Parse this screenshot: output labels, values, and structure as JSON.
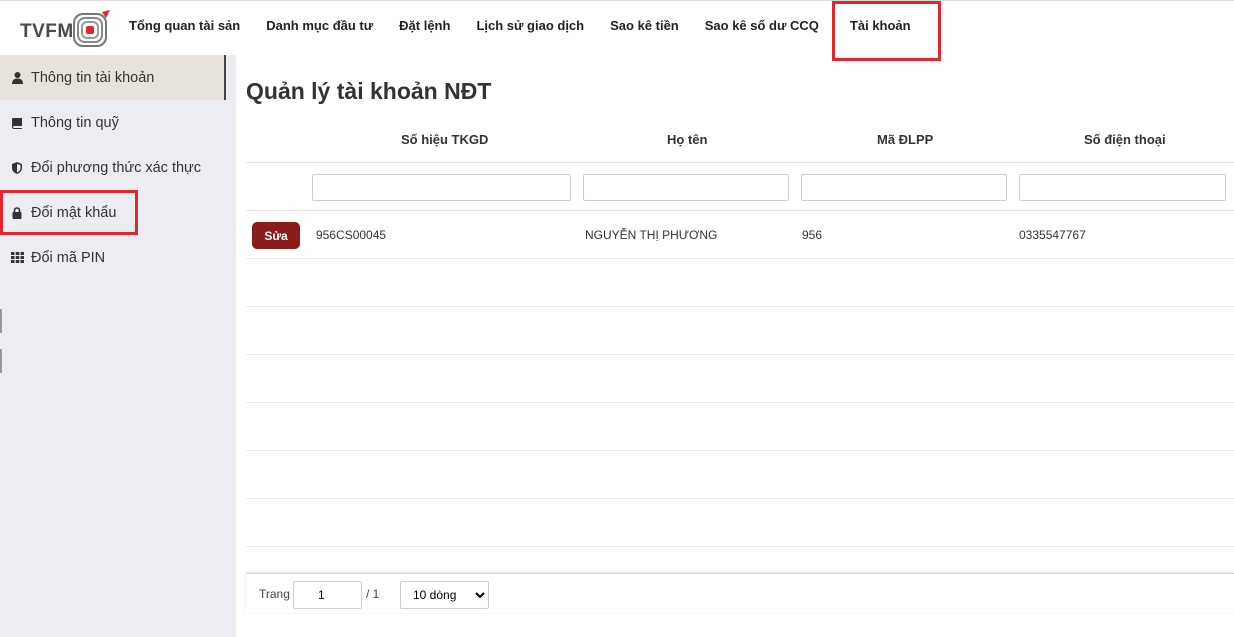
{
  "brand": {
    "logo_text": "TVFM"
  },
  "nav": {
    "items": [
      {
        "label": "Tổng quan tài sản"
      },
      {
        "label": "Danh mục đầu tư"
      },
      {
        "label": "Đặt lệnh"
      },
      {
        "label": "Lịch sử giao dịch"
      },
      {
        "label": "Sao kê tiền"
      },
      {
        "label": "Sao kê số dư CCQ"
      },
      {
        "label": "Tài khoản"
      }
    ],
    "active_index": 6
  },
  "sidebar": {
    "items": [
      {
        "label": "Thông tin tài khoản",
        "icon": "user-icon"
      },
      {
        "label": "Thông tin quỹ",
        "icon": "book-icon"
      },
      {
        "label": "Đổi phương thức xác thực",
        "icon": "shield-icon"
      },
      {
        "label": "Đổi mật khẩu",
        "icon": "lock-icon"
      },
      {
        "label": "Đổi mã PIN",
        "icon": "keypad-icon"
      }
    ]
  },
  "main": {
    "title": "Quản lý tài khoản NĐT",
    "columns": [
      "Số hiệu TKGD",
      "Họ tên",
      "Mã ĐLPP",
      "Số điện thoại"
    ],
    "rows": [
      {
        "action": "Sửa",
        "account": "956CS00045",
        "name": "NGUYỄN THỊ PHƯƠNG",
        "agent": "956",
        "phone": "0335547767"
      }
    ]
  },
  "pager": {
    "page_label": "Trang",
    "page_value": "1",
    "total": "/ 1",
    "page_size": "10 dòng",
    "page_size_options": [
      "10 dòng"
    ]
  },
  "colors": {
    "accent_red": "#e3252d",
    "button_red": "#8b1c1c",
    "sidebar_bg": "#ebedf3"
  }
}
